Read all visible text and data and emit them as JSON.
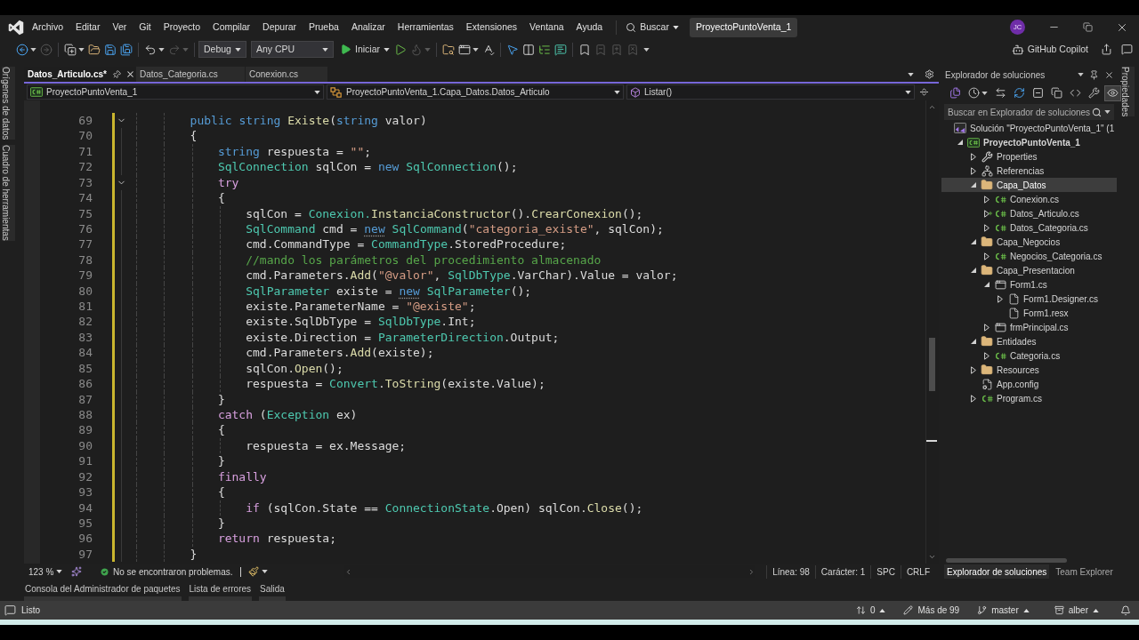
{
  "menu_bar": {
    "items": [
      "Archivo",
      "Editar",
      "Ver",
      "Git",
      "Proyecto",
      "Compilar",
      "Depurar",
      "Prueba",
      "Analizar",
      "Herramientas",
      "Extensiones",
      "Ventana",
      "Ayuda"
    ],
    "search_label": "Buscar",
    "solution_name": "ProyectoPuntoVenta_1",
    "account_initials": "JC"
  },
  "toolbar": {
    "groups_left": [
      [
        {
          "kind": "back",
          "disabled": false
        },
        {
          "kind": "forward",
          "disabled": true
        }
      ],
      [
        {
          "kind": "new_item",
          "disabled": false
        },
        {
          "kind": "open",
          "disabled": false
        },
        {
          "kind": "save",
          "disabled": false
        },
        {
          "kind": "save_all",
          "disabled": false
        }
      ],
      [
        {
          "kind": "undo",
          "disabled": false
        },
        {
          "kind": "redo",
          "disabled": true
        }
      ]
    ],
    "configuration": "Debug",
    "platform": "Any CPU",
    "start_label": "Iniciar",
    "groups_right": [
      [
        {
          "kind": "run_without_debugging",
          "disabled": false
        },
        {
          "kind": "hot_reload",
          "disabled": true
        }
      ],
      [
        {
          "kind": "folder_search",
          "disabled": false
        },
        {
          "kind": "window",
          "disabled": false
        },
        {
          "kind": "spell_check",
          "disabled": false
        }
      ],
      [
        {
          "kind": "pointer",
          "disabled": false
        },
        {
          "kind": "columns",
          "disabled": false
        },
        {
          "kind": "indent",
          "disabled": false
        },
        {
          "kind": "comment",
          "disabled": false
        }
      ],
      [
        {
          "kind": "bookmark",
          "disabled": false
        },
        {
          "kind": "bookmark_previous",
          "disabled": true
        },
        {
          "kind": "bookmark_next",
          "disabled": true
        },
        {
          "kind": "bookmark_clear",
          "disabled": true
        }
      ]
    ],
    "copilot_label": "GitHub Copilot"
  },
  "side_panels_left": [
    "Orígenes de datos",
    "Cuadro de herramientas"
  ],
  "side_panels_right": [
    "Propiedades"
  ],
  "editor": {
    "tabs": [
      {
        "label": "Datos_Articulo.cs*",
        "selected": true
      },
      {
        "label": "Datos_Categoria.cs",
        "selected": false
      },
      {
        "label": "Conexion.cs",
        "selected": false
      }
    ],
    "nav_bar": {
      "project": "ProyectoPuntoVenta_1",
      "type": "ProyectoPuntoVenta_1.Capa_Datos.Datos_Articulo",
      "member": "Listar()"
    },
    "lines": [
      {
        "number": "69",
        "changed": true,
        "expanded": true,
        "tokens": [
          {
            "kind": "keyword",
            "text": "        public string "
          },
          {
            "kind": "method",
            "text": "Existe"
          },
          {
            "kind": "plain",
            "text": "("
          },
          {
            "kind": "keyword",
            "text": "string "
          },
          {
            "kind": "plain",
            "text": "valor)"
          }
        ]
      },
      {
        "number": "70",
        "changed": true,
        "tokens": [
          {
            "kind": "plain",
            "text": "        {"
          }
        ]
      },
      {
        "number": "71",
        "changed": true,
        "tokens": [
          {
            "kind": "keyword",
            "text": "            string "
          },
          {
            "kind": "plain",
            "text": "respuesta = "
          },
          {
            "kind": "string",
            "text": "\"\""
          },
          {
            "kind": "plain",
            "text": ";"
          }
        ]
      },
      {
        "number": "72",
        "changed": true,
        "tokens": [
          {
            "kind": "type",
            "text": "            SqlConnection"
          },
          {
            "kind": "plain",
            "text": " sqlCon = "
          },
          {
            "kind": "keyword",
            "text": "new "
          },
          {
            "kind": "type",
            "text": "SqlConnection"
          },
          {
            "kind": "plain",
            "text": "();"
          }
        ]
      },
      {
        "number": "73",
        "changed": true,
        "expanded": true,
        "tokens": [
          {
            "kind": "control",
            "text": "            try"
          }
        ]
      },
      {
        "number": "74",
        "changed": true,
        "tokens": [
          {
            "kind": "plain",
            "text": "            {"
          }
        ]
      },
      {
        "number": "75",
        "changed": true,
        "tokens": [
          {
            "kind": "plain",
            "text": "                sqlCon = "
          },
          {
            "kind": "type",
            "text": "Conexion."
          },
          {
            "kind": "method",
            "text": "InstanciaConstructor"
          },
          {
            "kind": "plain",
            "text": "()."
          },
          {
            "kind": "method",
            "text": "CrearConexion"
          },
          {
            "kind": "plain",
            "text": "();"
          }
        ]
      },
      {
        "number": "76",
        "changed": true,
        "tokens": [
          {
            "kind": "type",
            "text": "                SqlCommand"
          },
          {
            "kind": "plain",
            "text": " cmd = "
          },
          {
            "kind": "keyword",
            "text": "new",
            "suggestion": true
          },
          {
            "kind": "type",
            "text": " SqlCommand"
          },
          {
            "kind": "plain",
            "text": "("
          },
          {
            "kind": "string",
            "text": "\"categoria_existe\""
          },
          {
            "kind": "plain",
            "text": ", sqlCon);"
          }
        ]
      },
      {
        "number": "77",
        "changed": true,
        "tokens": [
          {
            "kind": "plain",
            "text": "                cmd.CommandType = "
          },
          {
            "kind": "type",
            "text": "CommandType"
          },
          {
            "kind": "plain",
            "text": ".StoredProcedure;"
          }
        ]
      },
      {
        "number": "78",
        "changed": true,
        "tokens": [
          {
            "kind": "comment",
            "text": "                //mando los parámetros del procedimiento almacenado"
          }
        ]
      },
      {
        "number": "79",
        "changed": true,
        "tokens": [
          {
            "kind": "plain",
            "text": "                cmd.Parameters."
          },
          {
            "kind": "method",
            "text": "Add"
          },
          {
            "kind": "plain",
            "text": "("
          },
          {
            "kind": "string",
            "text": "\"@valor\""
          },
          {
            "kind": "plain",
            "text": ", "
          },
          {
            "kind": "type",
            "text": "SqlDbType"
          },
          {
            "kind": "plain",
            "text": ".VarChar).Value = valor;"
          }
        ]
      },
      {
        "number": "80",
        "changed": true,
        "tokens": [
          {
            "kind": "type",
            "text": "                SqlParameter"
          },
          {
            "kind": "plain",
            "text": " existe = "
          },
          {
            "kind": "keyword",
            "text": "new",
            "suggestion": true
          },
          {
            "kind": "type",
            "text": " SqlParameter"
          },
          {
            "kind": "plain",
            "text": "();"
          }
        ]
      },
      {
        "number": "81",
        "changed": true,
        "tokens": [
          {
            "kind": "plain",
            "text": "                existe.ParameterName = "
          },
          {
            "kind": "string",
            "text": "\"@existe\""
          },
          {
            "kind": "plain",
            "text": ";"
          }
        ]
      },
      {
        "number": "82",
        "changed": true,
        "tokens": [
          {
            "kind": "plain",
            "text": "                existe.SqlDbType = "
          },
          {
            "kind": "type",
            "text": "SqlDbType"
          },
          {
            "kind": "plain",
            "text": ".Int;"
          }
        ]
      },
      {
        "number": "83",
        "changed": true,
        "tokens": [
          {
            "kind": "plain",
            "text": "                existe.Direction = "
          },
          {
            "kind": "type",
            "text": "ParameterDirection"
          },
          {
            "kind": "plain",
            "text": ".Output;"
          }
        ]
      },
      {
        "number": "84",
        "changed": true,
        "tokens": [
          {
            "kind": "plain",
            "text": "                cmd.Parameters."
          },
          {
            "kind": "method",
            "text": "Add"
          },
          {
            "kind": "plain",
            "text": "(existe);"
          }
        ]
      },
      {
        "number": "85",
        "changed": true,
        "tokens": [
          {
            "kind": "plain",
            "text": "                sqlCon."
          },
          {
            "kind": "method",
            "text": "Open"
          },
          {
            "kind": "plain",
            "text": "();"
          }
        ]
      },
      {
        "number": "86",
        "changed": true,
        "tokens": [
          {
            "kind": "plain",
            "text": "                respuesta = "
          },
          {
            "kind": "type",
            "text": "Convert"
          },
          {
            "kind": "plain",
            "text": "."
          },
          {
            "kind": "method",
            "text": "ToString"
          },
          {
            "kind": "plain",
            "text": "(existe.Value);"
          }
        ]
      },
      {
        "number": "87",
        "changed": true,
        "tokens": [
          {
            "kind": "plain",
            "text": "            }"
          }
        ]
      },
      {
        "number": "88",
        "changed": true,
        "tokens": [
          {
            "kind": "control",
            "text": "            catch"
          },
          {
            "kind": "plain",
            "text": " ("
          },
          {
            "kind": "type",
            "text": "Exception"
          },
          {
            "kind": "plain",
            "text": " ex)"
          }
        ]
      },
      {
        "number": "89",
        "changed": true,
        "tokens": [
          {
            "kind": "plain",
            "text": "            {"
          }
        ]
      },
      {
        "number": "90",
        "changed": true,
        "tokens": [
          {
            "kind": "plain",
            "text": "                respuesta = ex.Message;"
          }
        ]
      },
      {
        "number": "91",
        "changed": true,
        "tokens": [
          {
            "kind": "plain",
            "text": "            }"
          }
        ]
      },
      {
        "number": "92",
        "changed": true,
        "tokens": [
          {
            "kind": "control",
            "text": "            finally"
          }
        ]
      },
      {
        "number": "93",
        "changed": true,
        "tokens": [
          {
            "kind": "plain",
            "text": "            {"
          }
        ]
      },
      {
        "number": "94",
        "changed": true,
        "tokens": [
          {
            "kind": "control",
            "text": "                if"
          },
          {
            "kind": "plain",
            "text": " (sqlCon.State == "
          },
          {
            "kind": "type",
            "text": "ConnectionState"
          },
          {
            "kind": "plain",
            "text": ".Open) sqlCon."
          },
          {
            "kind": "method",
            "text": "Close"
          },
          {
            "kind": "plain",
            "text": "();"
          }
        ]
      },
      {
        "number": "95",
        "changed": true,
        "tokens": [
          {
            "kind": "plain",
            "text": "            }"
          }
        ]
      },
      {
        "number": "96",
        "changed": true,
        "tokens": [
          {
            "kind": "control",
            "text": "            return"
          },
          {
            "kind": "plain",
            "text": " respuesta;"
          }
        ]
      },
      {
        "number": "97",
        "changed": true,
        "tokens": [
          {
            "kind": "plain",
            "text": "        }"
          }
        ]
      }
    ],
    "status": {
      "zoom": "123 %",
      "problems": "No se encontraron problemas.",
      "line": "Línea: 98",
      "character": "Carácter: 1",
      "indentation": "SPC",
      "line_endings": "CRLF"
    }
  },
  "solution_explorer": {
    "title": "Explorador de soluciones",
    "toolbar": [
      {
        "kind": "switch_views",
        "on": false
      },
      {
        "kind": "history",
        "on": false
      },
      {
        "kind": "sync",
        "on": false
      },
      {
        "kind": "refresh",
        "on": false
      },
      {
        "kind": "collapse_all",
        "on": false
      },
      {
        "kind": "show_all_files",
        "on": false
      },
      {
        "kind": "code_view",
        "on": false
      },
      {
        "kind": "properties",
        "on": false
      },
      {
        "kind": "preview",
        "on": true
      }
    ],
    "search": {
      "placeholder": "Buscar en Explorador de soluciones"
    },
    "tree": [
      {
        "label": "Solución \"ProyectoPuntoVenta_1\" (1",
        "kind": "solution",
        "selected": false,
        "children": [
          {
            "label": "ProyectoPuntoVenta_1",
            "kind": "project",
            "selected": false,
            "expanded": true,
            "children": [
              {
                "label": "Properties",
                "kind": "properties",
                "selected": false,
                "expanded": false
              },
              {
                "label": "Referencias",
                "kind": "references",
                "selected": false,
                "expanded": false
              },
              {
                "label": "Capa_Datos",
                "kind": "folder",
                "selected": true,
                "expanded": true,
                "children": [
                  {
                    "label": "Conexion.cs",
                    "kind": "csharp",
                    "selected": false,
                    "expanded": false,
                    "added": false
                  },
                  {
                    "label": "Datos_Articulo.cs",
                    "kind": "csharp",
                    "selected": false,
                    "expanded": false,
                    "added": true
                  },
                  {
                    "label": "Datos_Categoria.cs",
                    "kind": "csharp",
                    "selected": false,
                    "expanded": false,
                    "added": false
                  }
                ]
              },
              {
                "label": "Capa_Negocios",
                "kind": "folder",
                "selected": false,
                "expanded": true,
                "children": [
                  {
                    "label": "Negocios_Categoria.cs",
                    "kind": "csharp",
                    "selected": false,
                    "expanded": false
                  }
                ]
              },
              {
                "label": "Capa_Presentacion",
                "kind": "folder",
                "selected": false,
                "expanded": true,
                "children": [
                  {
                    "label": "Form1.cs",
                    "kind": "form",
                    "selected": false,
                    "expanded": true,
                    "children": [
                      {
                        "label": "Form1.Designer.cs",
                        "kind": "file",
                        "selected": false,
                        "expanded": false
                      },
                      {
                        "label": "Form1.resx",
                        "kind": "file",
                        "selected": false
                      }
                    ]
                  },
                  {
                    "label": "frmPrincipal.cs",
                    "kind": "form",
                    "selected": false,
                    "expanded": false
                  }
                ]
              },
              {
                "label": "Entidades",
                "kind": "folder",
                "selected": false,
                "expanded": true,
                "children": [
                  {
                    "label": "Categoria.cs",
                    "kind": "csharp",
                    "selected": false,
                    "expanded": false
                  }
                ]
              },
              {
                "label": "Resources",
                "kind": "folder",
                "selected": false,
                "expanded": false
              },
              {
                "label": "App.config",
                "kind": "config",
                "selected": false
              },
              {
                "label": "Program.cs",
                "kind": "csharp",
                "selected": false,
                "expanded": false
              }
            ]
          }
        ]
      }
    ],
    "tabs": [
      {
        "label": "Explorador de soluciones",
        "selected": true
      },
      {
        "label": "Team Explorer",
        "selected": false
      }
    ]
  },
  "tool_tabs": [
    "Consola del Administrador de paquetes",
    "Lista de errores",
    "Salida"
  ],
  "status_bar": {
    "state": "Listo",
    "sync_count": "0",
    "changes": "Más de 99",
    "branch": "master",
    "repository": "alber"
  }
}
